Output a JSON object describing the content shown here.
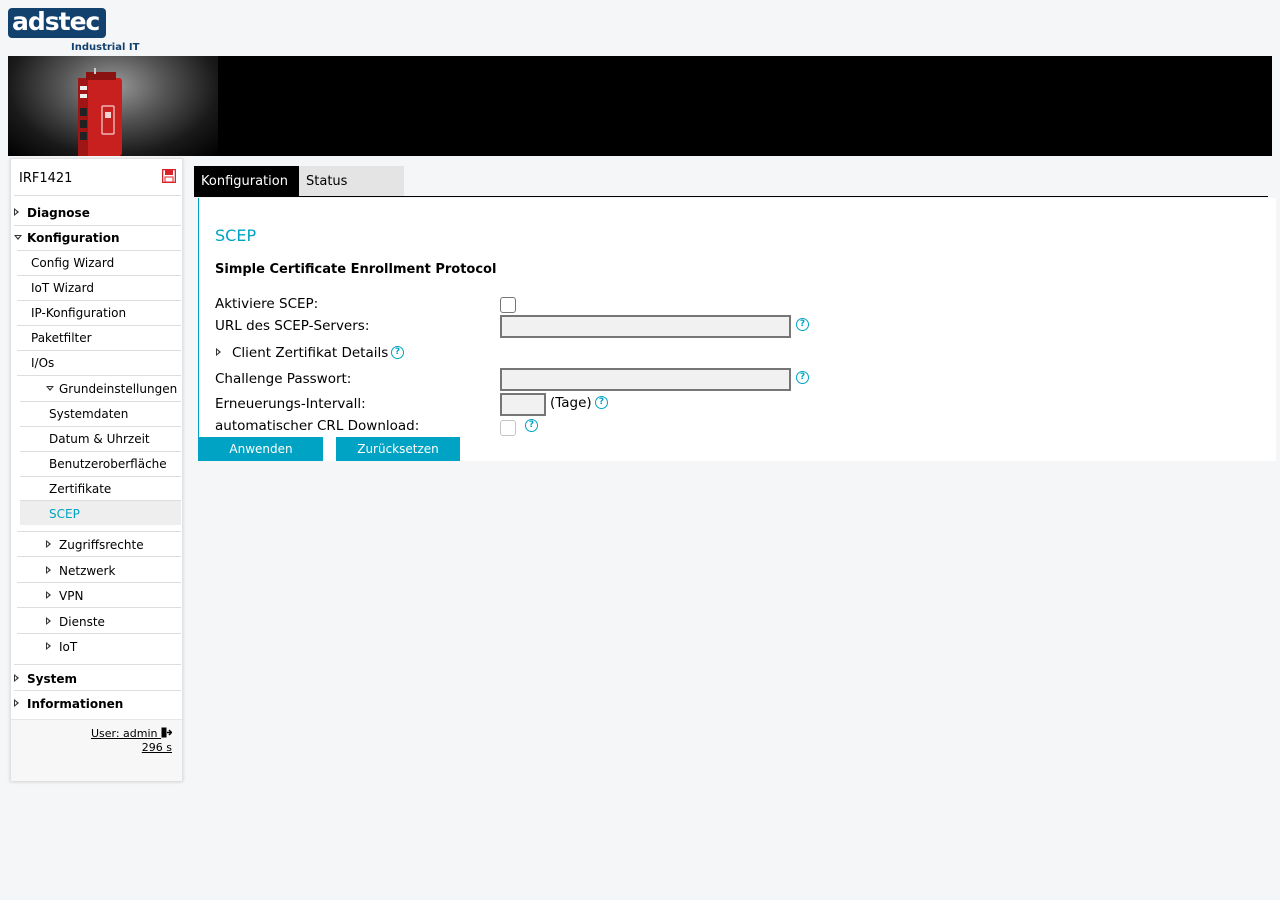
{
  "brand": {
    "logo_text": "adstec",
    "logo_sub": "Industrial IT"
  },
  "sidebar": {
    "device_name": "IRF1421",
    "items": [
      {
        "label": "Diagnose"
      },
      {
        "label": "Konfiguration"
      },
      {
        "label": "Config Wizard"
      },
      {
        "label": "IoT Wizard"
      },
      {
        "label": "IP-Konfiguration"
      },
      {
        "label": "Paketfilter"
      },
      {
        "label": "I/Os"
      },
      {
        "label": "Grundeinstellungen"
      },
      {
        "label": "Systemdaten"
      },
      {
        "label": "Datum & Uhrzeit"
      },
      {
        "label": "Benutzeroberfläche"
      },
      {
        "label": "Zertifikate"
      },
      {
        "label": "SCEP"
      },
      {
        "label": "Zugriffsrechte"
      },
      {
        "label": "Netzwerk"
      },
      {
        "label": "VPN"
      },
      {
        "label": "Dienste"
      },
      {
        "label": "IoT"
      },
      {
        "label": "System"
      },
      {
        "label": "Informationen"
      }
    ],
    "user": "User: admin",
    "timer": "296 s"
  },
  "tabs": {
    "config": "Konfiguration",
    "status": "Status"
  },
  "main": {
    "title": "SCEP",
    "subtitle": "Simple Certificate Enrollment Protocol",
    "labels": {
      "activate": "Aktiviere SCEP:",
      "url": "URL des SCEP-Servers:",
      "client_cert": "Client Zertifikat Details",
      "challenge": "Challenge Passwort:",
      "interval": "Erneuerungs-Intervall:",
      "crl": "automatischer CRL Download:"
    },
    "interval_unit": "(Tage)",
    "buttons": {
      "apply": "Anwenden",
      "reset": "Zurücksetzen"
    }
  },
  "colors": {
    "accent": "#00a3c4",
    "brand": "#13416e",
    "save_red": "#d8232a"
  }
}
